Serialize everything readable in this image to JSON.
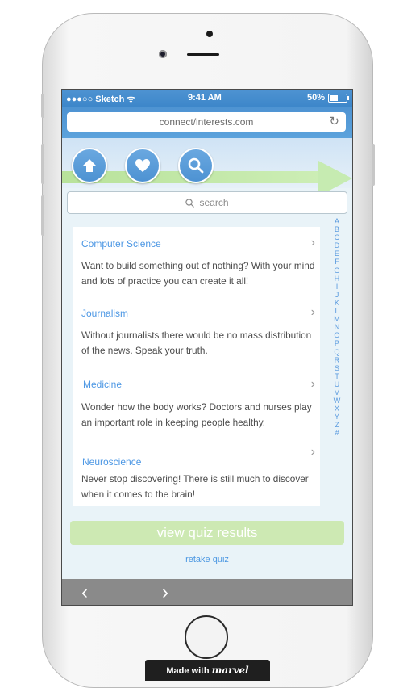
{
  "status_bar": {
    "carrier": "●●●○○ Sketch ᯤ",
    "time": "9:41 AM",
    "battery_label": "50%",
    "battery_level": 0.5
  },
  "browser": {
    "url": "connect/interests.com",
    "reload_icon": "reload-icon"
  },
  "hero": {
    "buttons": [
      "home-icon",
      "heart-icon",
      "search-icon"
    ],
    "stripe_color": "#c6ebb1"
  },
  "search": {
    "placeholder": "search"
  },
  "interests": [
    {
      "title": "Computer Science",
      "description": "Want to build something out of nothing? With your mind and lots of practice you can create it all!"
    },
    {
      "title": "Journalism",
      "description": "Without journalists there would be no mass distribution of the news. Speak your truth."
    },
    {
      "title": "Medicine",
      "description": "Wonder how the body works? Doctors and nurses play an important role in keeping people healthy."
    },
    {
      "title": "Neuroscience",
      "description": "Never stop discovering! There is still much to discover when it comes to the brain!"
    }
  ],
  "alphabet": [
    "A",
    "B",
    "C",
    "D",
    "E",
    "F",
    "G",
    "H",
    "I",
    "J",
    "K",
    "L",
    "M",
    "N",
    "O",
    "P",
    "Q",
    "R",
    "S",
    "T",
    "U",
    "V",
    "W",
    "X",
    "Y",
    "Z",
    "#"
  ],
  "actions": {
    "view_results": "view quiz results",
    "retake": "retake quiz"
  },
  "nav": {
    "back": "‹",
    "forward": "›"
  },
  "badge": {
    "prefix": "Made with",
    "brand": "marvel"
  },
  "colors": {
    "accent": "#4c97e4",
    "quiz_button": "#cde9b3",
    "bottom_bar": "#8a8a8a"
  }
}
